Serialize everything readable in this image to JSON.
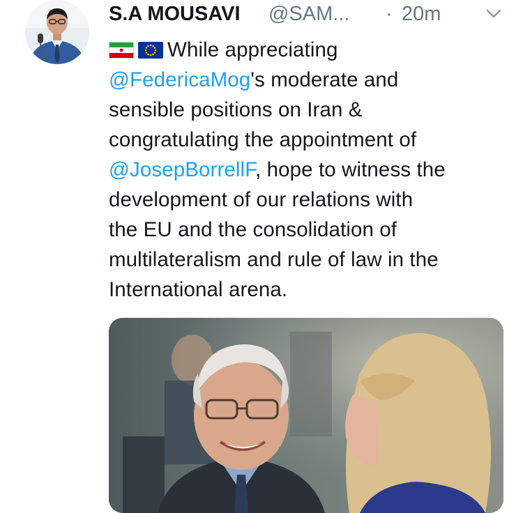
{
  "tweet": {
    "author_name": "S.A MOUSAVI",
    "author_handle": "@SAM...",
    "separator": "·",
    "time": "20m",
    "body": {
      "line1_text": "While appreciating",
      "line2_mention": "@FedericaMog",
      "line2_text": "'s moderate and",
      "line3": "sensible positions on Iran &",
      "line4": "congratulating the appointment of",
      "line5_mention": "@JosepBorrellF",
      "line5_text": ", hope to witness the",
      "line6": "development of our relations with",
      "line7": "the EU and the consolidation of",
      "line8": "multilateralism and rule of law in the",
      "line9": "International arena."
    },
    "icons": {
      "iran_flag": "iran-flag-icon",
      "eu_flag": "eu-flag-icon",
      "menu": "chevron-down-icon"
    },
    "colors": {
      "mention": "#1da1f2",
      "secondary_text": "#657786",
      "primary_text": "#14171a"
    }
  }
}
